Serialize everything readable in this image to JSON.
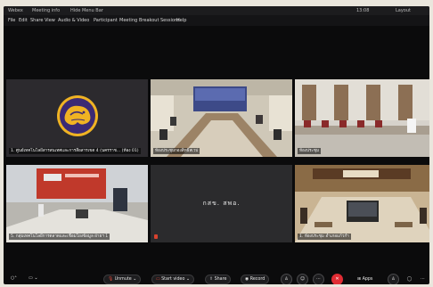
{
  "titlebar": {
    "app": "Webex",
    "meeting": "Meeting info",
    "hide": "Hide Menu Bar",
    "time": "13:08",
    "layout": "Layout"
  },
  "menu": [
    "File",
    "Edit",
    "Share",
    "View",
    "Audio & Video",
    "Participant",
    "Meeting",
    "Breakout Sessions",
    "Help"
  ],
  "tiles": [
    {
      "label": "1. ศูนย์เทคโนโลยีสารสนเทศและการสื่อสารเขต 4 (นครราช...  (ห้อง 01)"
    },
    {
      "label": "ห้องประชุมกองสิทธิ์สเวป"
    },
    {
      "label": "ห้องประชุม"
    },
    {
      "label": "5. กลุ่มเทคโนโลยีการตลาดและเชื่อมโยงข้อมูล ฝ่ายฯ 1"
    },
    {
      "label": "",
      "center": "กสข. สพอ."
    },
    {
      "label": "1. ห้องประชุม อำเภอแก้วกำ"
    }
  ],
  "controls": {
    "unmute": "Unmute",
    "start_video": "Start video",
    "share": "Share",
    "record": "Record",
    "apps": "Apps"
  },
  "colors": {
    "end_call": "#e02c34",
    "logo_bg": "#3b2a74",
    "logo_gold": "#f0b323"
  }
}
